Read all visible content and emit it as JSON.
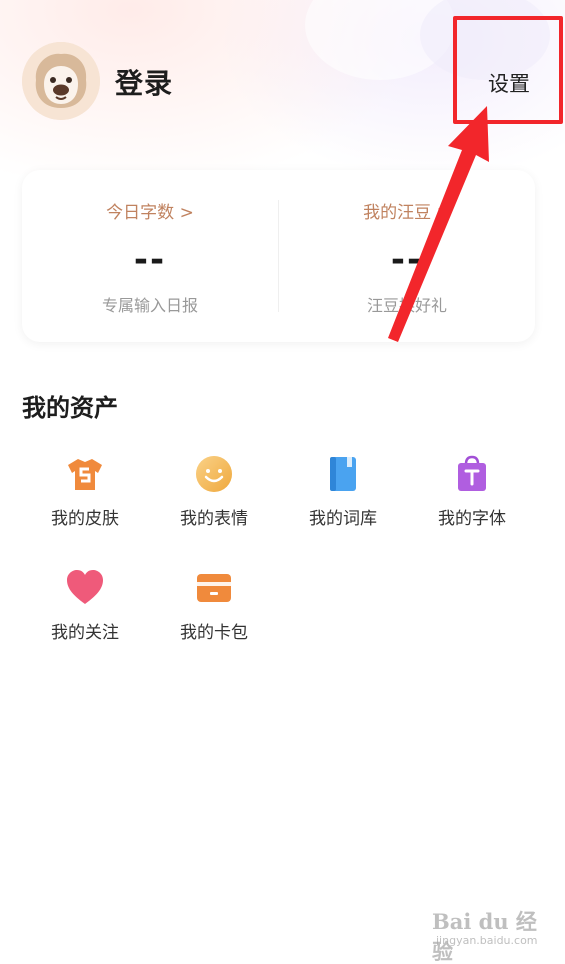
{
  "header": {
    "login_label": "登录",
    "settings_label": "设置"
  },
  "stats": [
    {
      "title": "今日字数 >",
      "value": "--",
      "subtitle": "专属输入日报"
    },
    {
      "title": "我的汪豆 >",
      "value": "--",
      "subtitle": "汪豆换好礼"
    }
  ],
  "assets": {
    "title": "我的资产",
    "items": [
      {
        "label": "我的皮肤",
        "icon": "skin-shirt-icon"
      },
      {
        "label": "我的表情",
        "icon": "smiley-icon"
      },
      {
        "label": "我的词库",
        "icon": "book-icon"
      },
      {
        "label": "我的字体",
        "icon": "font-bag-icon"
      },
      {
        "label": "我的关注",
        "icon": "heart-icon"
      },
      {
        "label": "我的卡包",
        "icon": "card-wallet-icon"
      }
    ]
  },
  "annotation": {
    "highlight_color": "#f2262b"
  },
  "watermark": {
    "main": "Bai du 经验",
    "sub": "jingyan.baidu.com"
  }
}
